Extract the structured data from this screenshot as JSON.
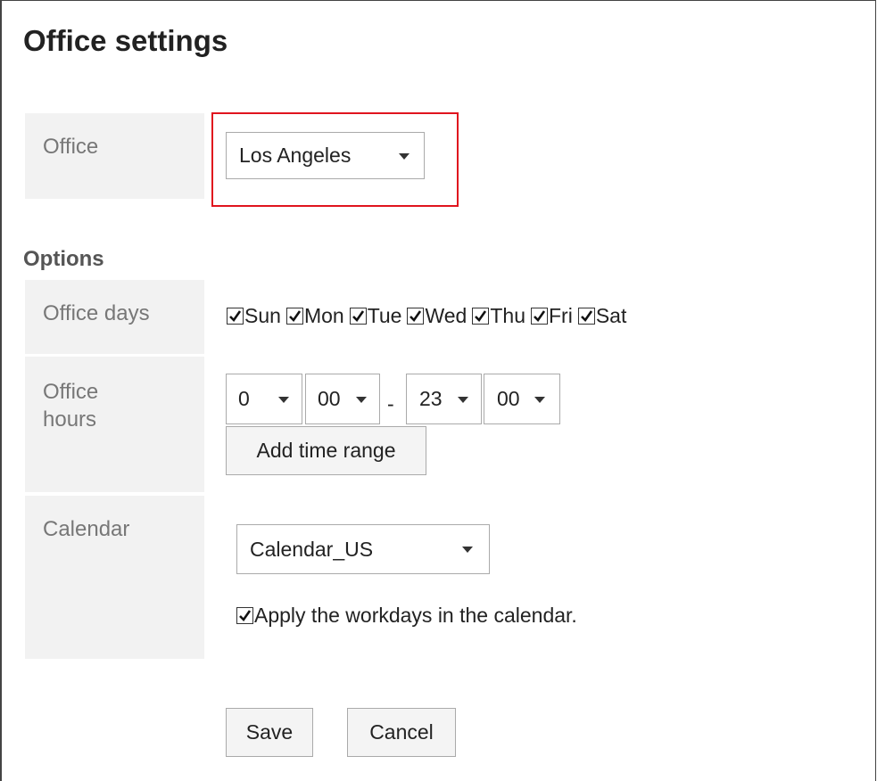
{
  "page": {
    "title": "Office settings"
  },
  "office": {
    "label": "Office",
    "selected": "Los Angeles"
  },
  "options": {
    "heading": "Options",
    "office_days": {
      "label": "Office days",
      "days": [
        {
          "name": "Sun",
          "checked": true
        },
        {
          "name": "Mon",
          "checked": true
        },
        {
          "name": "Tue",
          "checked": true
        },
        {
          "name": "Wed",
          "checked": true
        },
        {
          "name": "Thu",
          "checked": true
        },
        {
          "name": "Fri",
          "checked": true
        },
        {
          "name": "Sat",
          "checked": true
        }
      ]
    },
    "office_hours": {
      "label_line1": "Office",
      "label_line2": "hours",
      "start_hour": "0",
      "start_minute": "00",
      "separator": "-",
      "end_hour": "23",
      "end_minute": "00",
      "add_time_range_label": "Add time range"
    },
    "calendar": {
      "label": "Calendar",
      "selected": "Calendar_US",
      "apply_workdays_label": "Apply the workdays in the calendar.",
      "apply_workdays_checked": true
    }
  },
  "actions": {
    "save_label": "Save",
    "cancel_label": "Cancel"
  },
  "colors": {
    "highlight": "#e0141e",
    "label_background": "#f2f2f2"
  }
}
